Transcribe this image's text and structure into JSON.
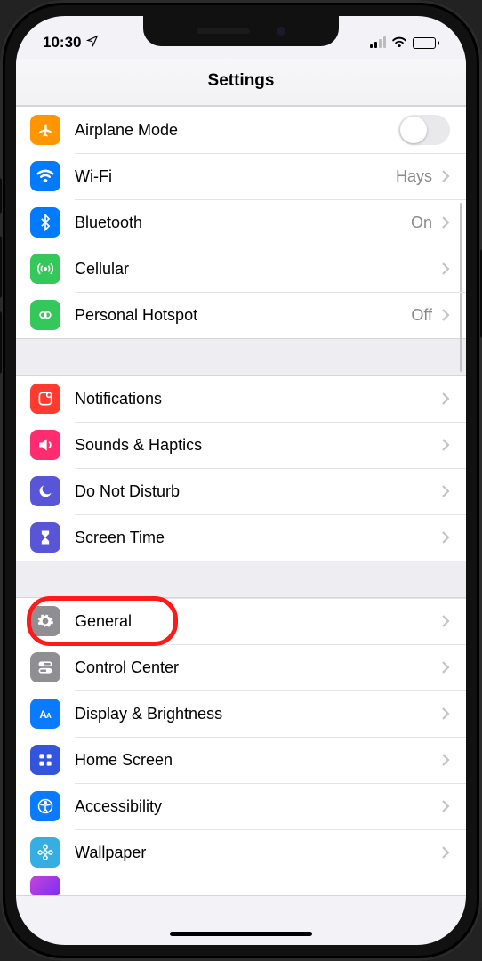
{
  "status": {
    "time": "10:30"
  },
  "header": {
    "title": "Settings"
  },
  "groups": [
    {
      "rows": [
        {
          "id": "airplane",
          "label": "Airplane Mode",
          "value": "",
          "kind": "toggle",
          "iconBg": "#ff9500"
        },
        {
          "id": "wifi",
          "label": "Wi-Fi",
          "value": "Hays",
          "kind": "link",
          "iconBg": "#007aff"
        },
        {
          "id": "bluetooth",
          "label": "Bluetooth",
          "value": "On",
          "kind": "link",
          "iconBg": "#007aff"
        },
        {
          "id": "cellular",
          "label": "Cellular",
          "value": "",
          "kind": "link",
          "iconBg": "#34c759"
        },
        {
          "id": "hotspot",
          "label": "Personal Hotspot",
          "value": "Off",
          "kind": "link",
          "iconBg": "#34c759"
        }
      ]
    },
    {
      "rows": [
        {
          "id": "notifications",
          "label": "Notifications",
          "value": "",
          "kind": "link",
          "iconBg": "#ff3b30"
        },
        {
          "id": "sounds",
          "label": "Sounds & Haptics",
          "value": "",
          "kind": "link",
          "iconBg": "#ff2d70"
        },
        {
          "id": "dnd",
          "label": "Do Not Disturb",
          "value": "",
          "kind": "link",
          "iconBg": "#5856d6"
        },
        {
          "id": "screentime",
          "label": "Screen Time",
          "value": "",
          "kind": "link",
          "iconBg": "#5856d6"
        }
      ]
    },
    {
      "rows": [
        {
          "id": "general",
          "label": "General",
          "value": "",
          "kind": "link",
          "iconBg": "#8e8e93"
        },
        {
          "id": "controlcenter",
          "label": "Control Center",
          "value": "",
          "kind": "link",
          "iconBg": "#8e8e93"
        },
        {
          "id": "display",
          "label": "Display & Brightness",
          "value": "",
          "kind": "link",
          "iconBg": "#0a7aff"
        },
        {
          "id": "homescreen",
          "label": "Home Screen",
          "value": "",
          "kind": "link",
          "iconBg": "#3355dd"
        },
        {
          "id": "accessibility",
          "label": "Accessibility",
          "value": "",
          "kind": "link",
          "iconBg": "#0a7aff"
        },
        {
          "id": "wallpaper",
          "label": "Wallpaper",
          "value": "",
          "kind": "link",
          "iconBg": "#37aee2"
        }
      ]
    }
  ],
  "annotation": {
    "highlightRow": "general"
  }
}
